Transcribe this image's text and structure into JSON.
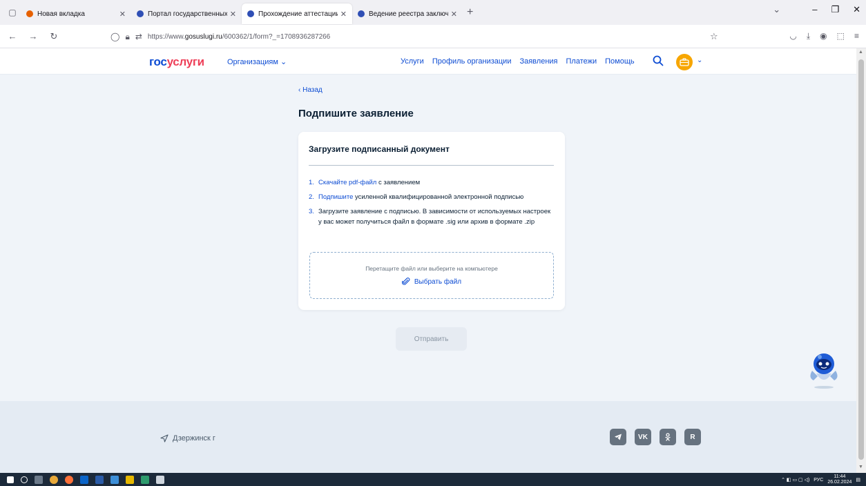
{
  "browser": {
    "tabs": [
      {
        "title": "Новая вкладка",
        "active": false,
        "favicon_color": "#e66000"
      },
      {
        "title": "Портал государственных услуг",
        "active": false,
        "favicon_color": "#2f4fb5"
      },
      {
        "title": "Прохождение аттестации | По",
        "active": true,
        "favicon_color": "#2f4fb5"
      },
      {
        "title": "Ведение реестра заключений",
        "active": false,
        "favicon_color": "#2f4fb5"
      }
    ],
    "url_prefix": "https://www.",
    "url_domain": "gosuslugi.ru",
    "url_path": "/600362/1/form?_=1708936287266"
  },
  "site": {
    "logo_part1": "гос",
    "logo_part2": "услуги",
    "org_menu": "Организациям",
    "nav_links": [
      "Услуги",
      "Профиль организации",
      "Заявления",
      "Платежи",
      "Помощь"
    ]
  },
  "page": {
    "back_label": "Назад",
    "title": "Подпишите заявление"
  },
  "card": {
    "title": "Загрузите подписанный документ",
    "steps": [
      {
        "num": "1.",
        "link": "Скачайте pdf-файл",
        "text": " с заявлением"
      },
      {
        "num": "2.",
        "link": "Подпишите",
        "text": " усиленной квалифицированной электронной подписью"
      },
      {
        "num": "3.",
        "link": "",
        "text": "Загрузите заявление с подписью. В зависимости от используемых настроек у вас может получиться файл в формате .sig или архив в формате .zip"
      }
    ],
    "dropzone_hint": "Перетащите файл или выберите на компьютере",
    "choose_file": "Выбрать файл"
  },
  "submit_label": "Отправить",
  "footer": {
    "location": "Дзержинск г",
    "socials": [
      "telegram-icon",
      "vk-icon",
      "ok-icon",
      "rutube-icon"
    ]
  },
  "taskbar": {
    "lang": "РУС",
    "time": "11:44",
    "date": "26.02.2024"
  },
  "colors": {
    "brand_blue": "#0d4cd3",
    "brand_red": "#ee3f58",
    "page_bg": "#f0f4f9",
    "footer_bg": "#e4ebf3"
  }
}
